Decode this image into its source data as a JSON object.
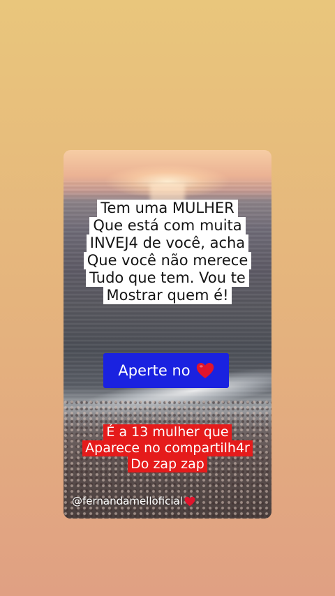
{
  "headline": {
    "lines": [
      "Tem uma MULHER",
      "Que está com muita",
      "INVEJ4 de você, acha",
      "Que você não merece",
      "Tudo que tem. Vou te",
      "Mostrar quem é!"
    ]
  },
  "button": {
    "label": "Aperte no",
    "icon": "heart-icon",
    "color": "#1a22e0"
  },
  "note": {
    "lines": [
      "É a 13 mulher que",
      "Aparece no compartilh4r",
      "Do zap zap"
    ],
    "color": "#e51b1b"
  },
  "author": {
    "handle": "@fernandamelloficial",
    "icon": "heart-icon"
  },
  "colors": {
    "heart": "#e0142c",
    "background_top": "#e9c67c",
    "background_bottom": "#e0a083"
  }
}
